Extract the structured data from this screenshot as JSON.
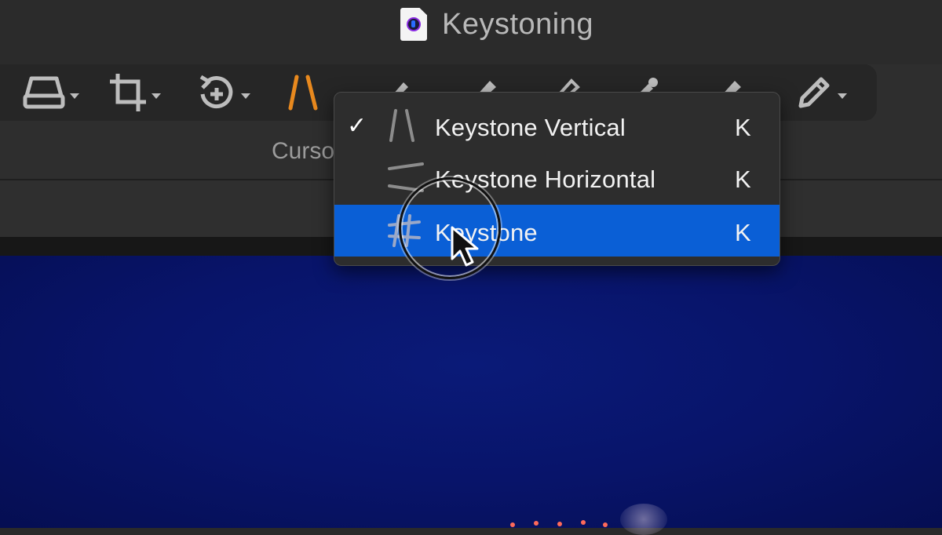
{
  "window": {
    "title": "Keystoning"
  },
  "toolbar": {
    "tools": [
      {
        "name": "print-layout-tool-icon",
        "selected": false
      },
      {
        "name": "crop-tool-icon",
        "selected": false
      },
      {
        "name": "rotate-tool-icon",
        "selected": false
      },
      {
        "name": "keystone-tool-icon",
        "selected": true
      },
      {
        "name": "brush-tool-icon",
        "selected": false
      },
      {
        "name": "pencil-tool-icon",
        "selected": false
      }
    ],
    "section_label": "Curso"
  },
  "menu": {
    "items": [
      {
        "label": "Keystone Vertical",
        "shortcut": "K",
        "checked": true,
        "check_mark": "✓",
        "icon": "keystone-vertical-icon"
      },
      {
        "label": "Keystone Horizontal",
        "shortcut": "K",
        "checked": false,
        "icon": "keystone-horizontal-icon"
      },
      {
        "label": "Keystone",
        "shortcut": "K",
        "checked": false,
        "highlighted": true,
        "icon": "keystone-grid-icon"
      }
    ]
  },
  "colors": {
    "accent_orange": "#e8891e",
    "menu_highlight": "#0a5fd6",
    "photo_sky": "#08146a"
  }
}
